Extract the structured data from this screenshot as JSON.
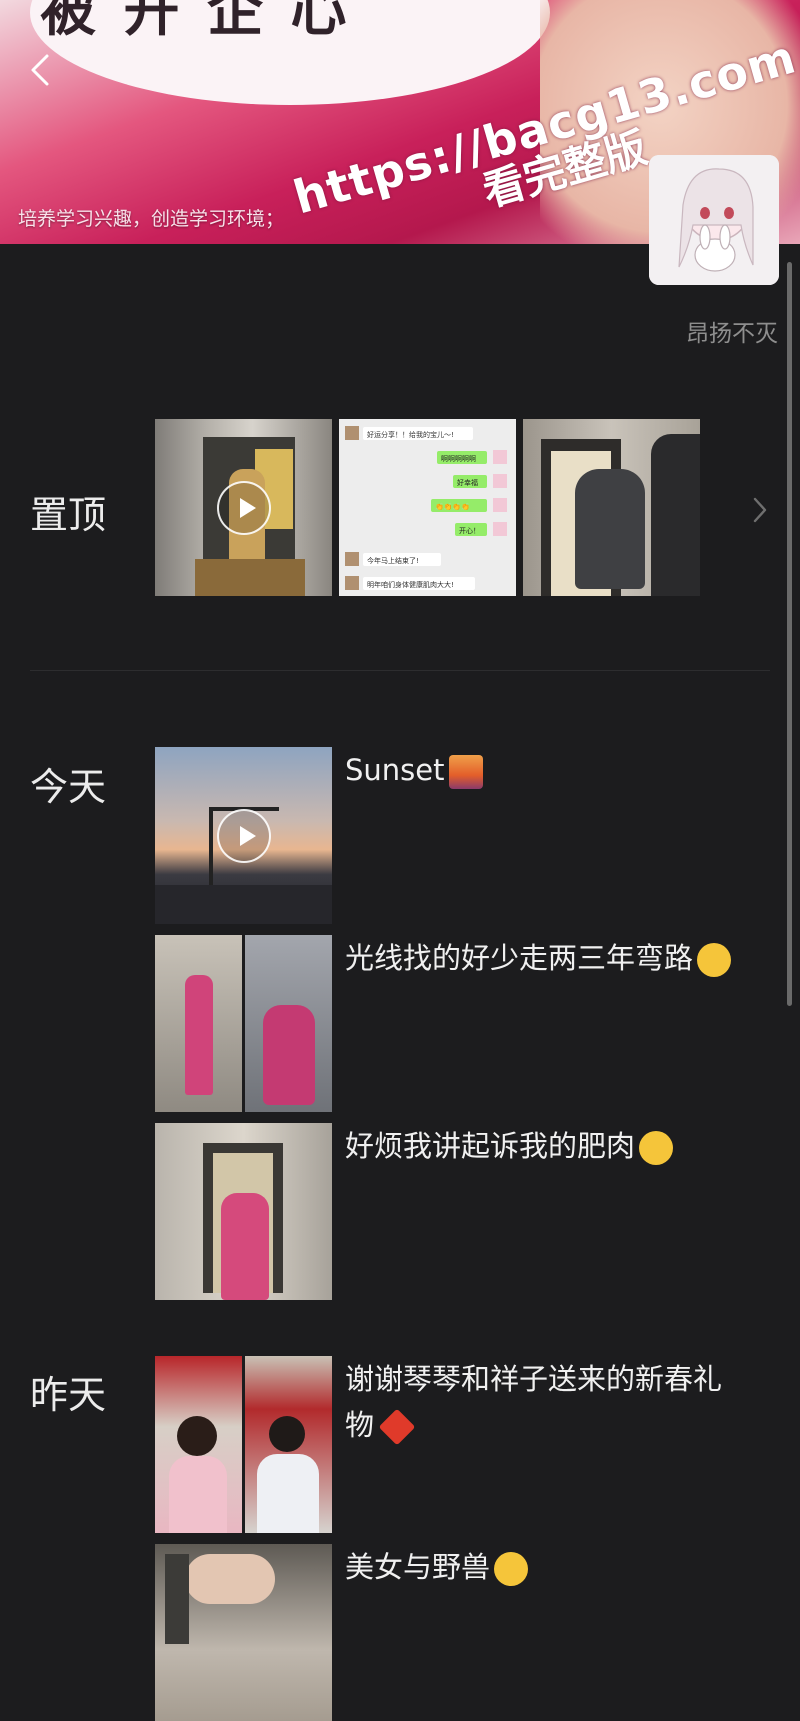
{
  "cover": {
    "bubble_text": "被 开 企 心",
    "caption": "培养学习兴趣，创造学习环境；",
    "watermark_url": "https://bacg13.com",
    "watermark_sub": "看完整版"
  },
  "nav": {
    "back_icon": "chevron-left-icon"
  },
  "profile": {
    "username": "昂扬不灭"
  },
  "sections": {
    "pinned_label": "置顶",
    "today_label": "今天",
    "yesterday_label": "昨天"
  },
  "pinned": {
    "chat_lines": [
      "好运分享！！给我的宝儿～!",
      "啊啊啊啊啊",
      "好幸福",
      "👏👏👏👏",
      "开心！",
      "今年马上结束了!",
      "明年咱们身体健康肌肉大大!"
    ]
  },
  "posts_today": [
    {
      "caption": "Sunset",
      "emoji": "sunset-emoji",
      "media": "video"
    },
    {
      "caption": "光线找的好少走两三年弯路",
      "emoji": "smile-emoji",
      "media": "photo-pair"
    },
    {
      "caption": "好烦我讲起诉我的肥肉",
      "emoji": "laugh-emoji",
      "media": "photo"
    }
  ],
  "posts_yesterday": [
    {
      "caption": "谢谢琴琴和祥子送来的新春礼物",
      "emoji": "red-diamond-emoji",
      "media": "photo-pair"
    },
    {
      "caption": "美女与野兽",
      "emoji": "smile-emoji",
      "media": "photo"
    }
  ],
  "colors": {
    "background": "#1c1c1e",
    "text": "#f0f0f0",
    "muted": "#8e8e8e",
    "accent": "#c8205a"
  }
}
